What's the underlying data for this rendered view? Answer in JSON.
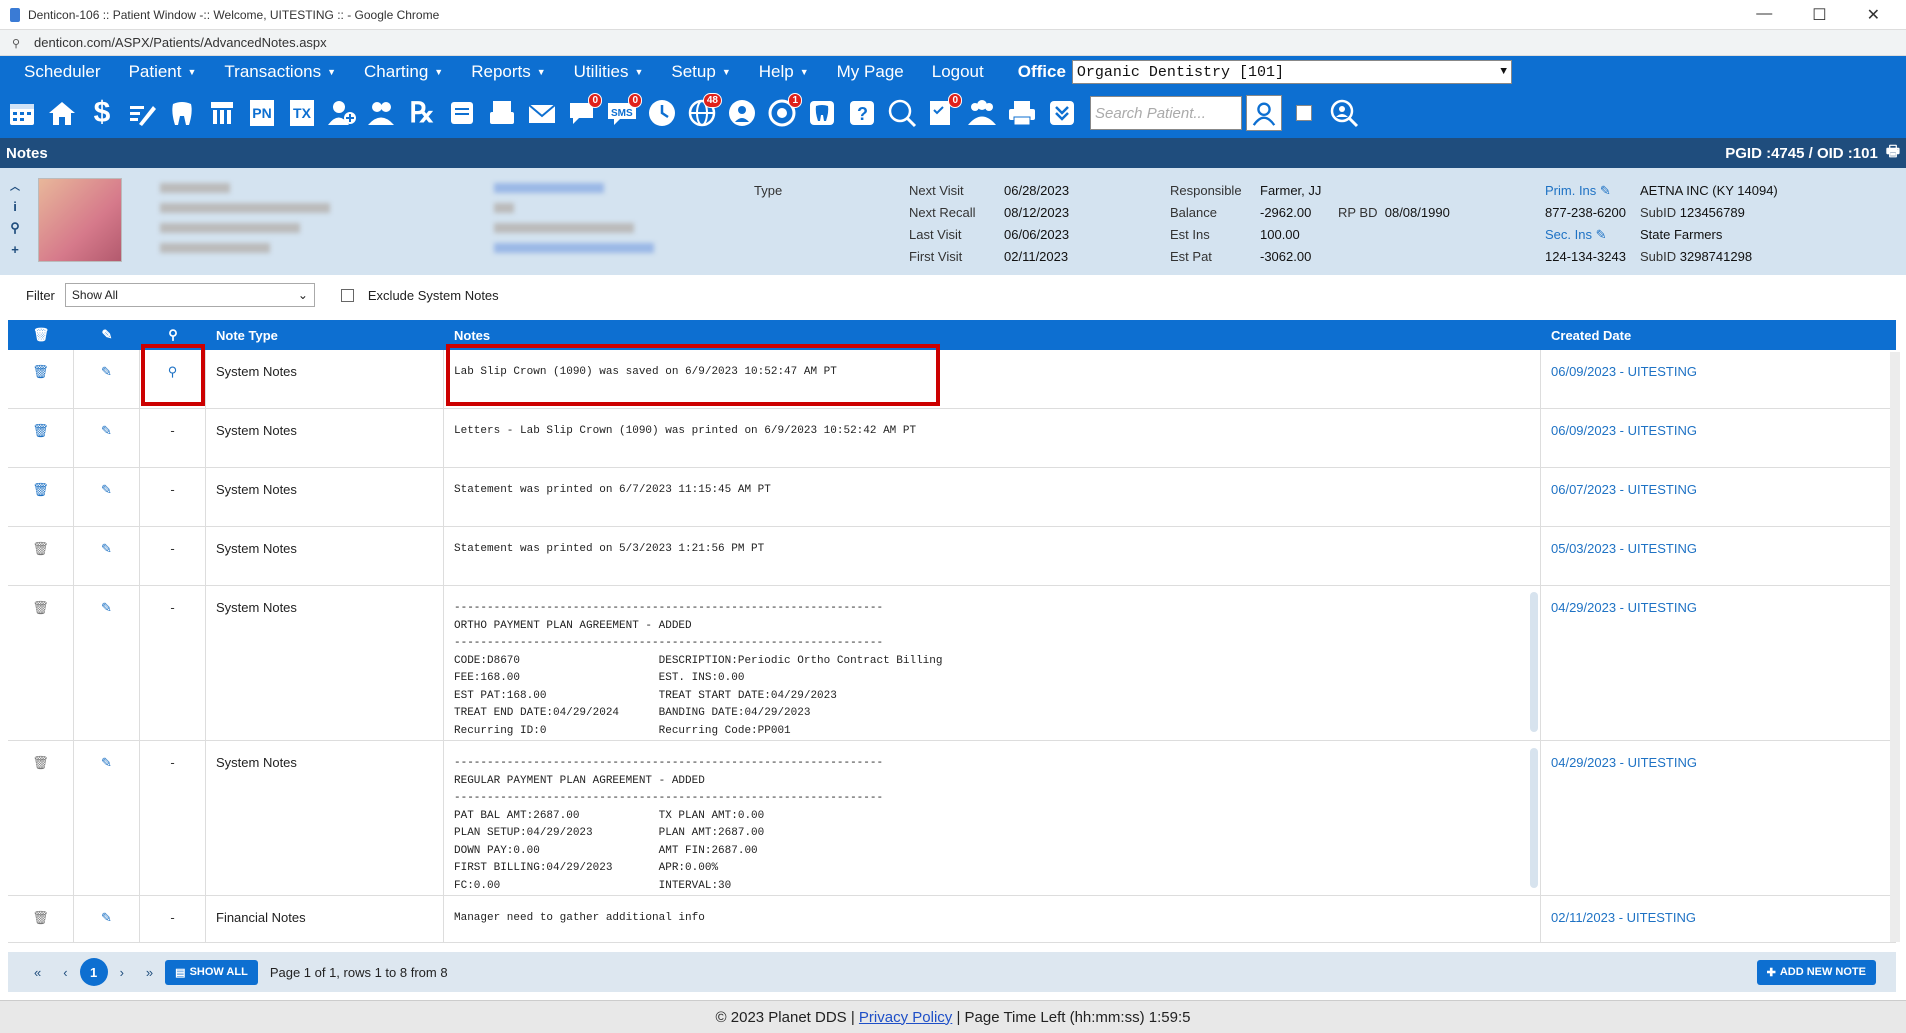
{
  "browser": {
    "title": "Denticon-106 :: Patient Window -:: Welcome, UITESTING :: - Google Chrome",
    "url": "denticon.com/ASPX/Patients/AdvancedNotes.aspx"
  },
  "menu": {
    "items": [
      "Scheduler",
      "Patient",
      "Transactions",
      "Charting",
      "Reports",
      "Utilities",
      "Setup",
      "Help",
      "My Page",
      "Logout"
    ],
    "office_label": "Office",
    "office_value": "Organic Dentistry [101]"
  },
  "toolbar": {
    "badges": {
      "sms": "0",
      "globe": "48",
      "recall": "1",
      "notes": "0"
    },
    "search_placeholder": "Search Patient..."
  },
  "header": {
    "title": "Notes",
    "ids": "PGID :4745 / OID :101"
  },
  "patient": {
    "type_label": "Type",
    "next_visit_label": "Next Visit",
    "next_visit": "06/28/2023",
    "next_recall_label": "Next Recall",
    "next_recall": "08/12/2023",
    "last_visit_label": "Last Visit",
    "last_visit": "06/06/2023",
    "first_visit_label": "First Visit",
    "first_visit": "02/11/2023",
    "responsible_label": "Responsible",
    "responsible": "Farmer, JJ",
    "balance_label": "Balance",
    "balance": "-2962.00",
    "rpbd_label": "RP BD",
    "rpbd": "08/08/1990",
    "est_ins_label": "Est Ins",
    "est_ins": "100.00",
    "est_pat_label": "Est Pat",
    "est_pat": "-3062.00",
    "prim_ins_label": "Prim. Ins",
    "prim_ins": "AETNA INC (KY 14094)",
    "prim_phone": "877-238-6200",
    "prim_subid_label": "SubID",
    "prim_subid": "123456789",
    "sec_ins_label": "Sec. Ins",
    "sec_ins": "State Farmers",
    "sec_phone": "124-134-3243",
    "sec_subid_label": "SubID",
    "sec_subid": "3298741298"
  },
  "filter": {
    "label": "Filter",
    "value": "Show All",
    "exclude_label": "Exclude System Notes"
  },
  "table": {
    "headers": {
      "type": "Note Type",
      "notes": "Notes",
      "date": "Created Date"
    },
    "rows": [
      {
        "type": "System Notes",
        "attach": "",
        "notes": "Lab Slip Crown (1090) was saved on 6/9/2023 10:52:47 AM PT",
        "date": "06/09/2023 - UITESTING"
      },
      {
        "type": "System Notes",
        "attach": "-",
        "notes": "Letters - Lab Slip Crown (1090) was printed on 6/9/2023 10:52:42 AM PT",
        "date": "06/09/2023 - UITESTING"
      },
      {
        "type": "System Notes",
        "attach": "-",
        "notes": "Statement was printed on 6/7/2023 11:15:45 AM PT",
        "date": "06/07/2023 - UITESTING"
      },
      {
        "type": "System Notes",
        "attach": "-",
        "notes": "Statement was printed on 5/3/2023 1:21:56 PM PT",
        "date": "05/03/2023 - UITESTING"
      },
      {
        "type": "System Notes",
        "attach": "-",
        "notes": "-----------------------------------------------------------------\nORTHO PAYMENT PLAN AGREEMENT - ADDED\n-----------------------------------------------------------------\nCODE:D8670                     DESCRIPTION:Periodic Ortho Contract Billing\nFEE:168.00                     EST. INS:0.00\nEST PAT:168.00                 TREAT START DATE:04/29/2023\nTREAT END DATE:04/29/2024      BANDING DATE:04/29/2023\nRecurring ID:0                 Recurring Code:PP001",
        "date": "04/29/2023 - UITESTING"
      },
      {
        "type": "System Notes",
        "attach": "-",
        "notes": "-----------------------------------------------------------------\nREGULAR PAYMENT PLAN AGREEMENT - ADDED\n-----------------------------------------------------------------\nPAT BAL AMT:2687.00            TX PLAN AMT:0.00\nPLAN SETUP:04/29/2023          PLAN AMT:2687.00\nDOWN PAY:0.00                  AMT FIN:2687.00\nFIRST BILLING:04/29/2023       APR:0.00%\nFC:0.00                        INTERVAL:30",
        "date": "04/29/2023 - UITESTING"
      },
      {
        "type": "Financial Notes",
        "attach": "-",
        "notes": "Manager need to gather additional info",
        "date": "02/11/2023 - UITESTING"
      }
    ]
  },
  "pager": {
    "current": "1",
    "show_all": "SHOW ALL",
    "summary": "Page 1 of 1, rows 1 to 8 from 8",
    "add_note": "ADD NEW NOTE"
  },
  "footer": {
    "copyright": "© 2023 Planet DDS |",
    "privacy": "Privacy Policy",
    "time_left": "| Page Time Left (hh:mm:ss) 1:59:5"
  }
}
